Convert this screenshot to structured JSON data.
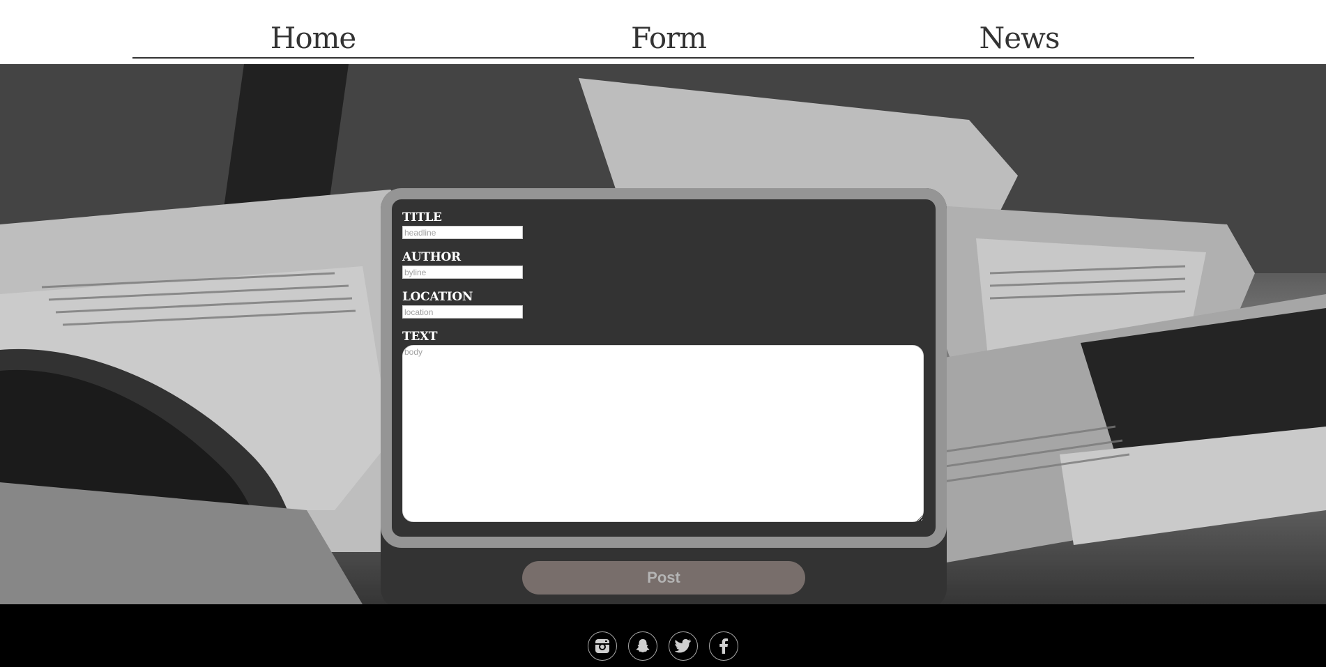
{
  "nav": {
    "items": [
      {
        "label": "Home"
      },
      {
        "label": "Form"
      },
      {
        "label": "News"
      }
    ]
  },
  "form": {
    "title_label": "TITLE",
    "title_placeholder": "headline",
    "title_value": "",
    "author_label": "AUTHOR",
    "author_placeholder": "byline",
    "author_value": "",
    "location_label": "LOCATION",
    "location_placeholder": "location",
    "location_value": "",
    "text_label": "TEXT",
    "text_placeholder": "body",
    "text_value": "",
    "submit_label": "Post"
  },
  "footer": {
    "social_icons": [
      "instagram-icon",
      "snapchat-icon",
      "twitter-icon",
      "facebook-icon"
    ]
  },
  "colors": {
    "nav_text": "#333333",
    "card_background": "#333333",
    "card_frame": "#959595",
    "button_background": "#786e6b",
    "button_text": "#b4b4b4",
    "footer_background": "#000000"
  }
}
